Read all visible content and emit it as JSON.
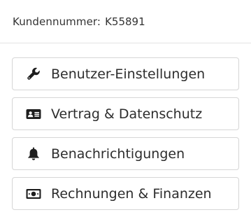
{
  "header": {
    "customer_label": "Kundennummer:",
    "customer_number": "K55891"
  },
  "menu": {
    "items": [
      {
        "icon": "wrench-icon",
        "label": "Benutzer-Einstellungen"
      },
      {
        "icon": "id-card-icon",
        "label": "Vertrag & Datenschutz"
      },
      {
        "icon": "bell-icon",
        "label": "Benachrichtigungen"
      },
      {
        "icon": "money-bill-icon",
        "label": "Rechnungen & Finanzen"
      }
    ]
  },
  "colors": {
    "icon": "#1e1e1e",
    "border": "#d6d6d6",
    "divider": "#e3e3e3",
    "text": "#2d2d2d"
  }
}
